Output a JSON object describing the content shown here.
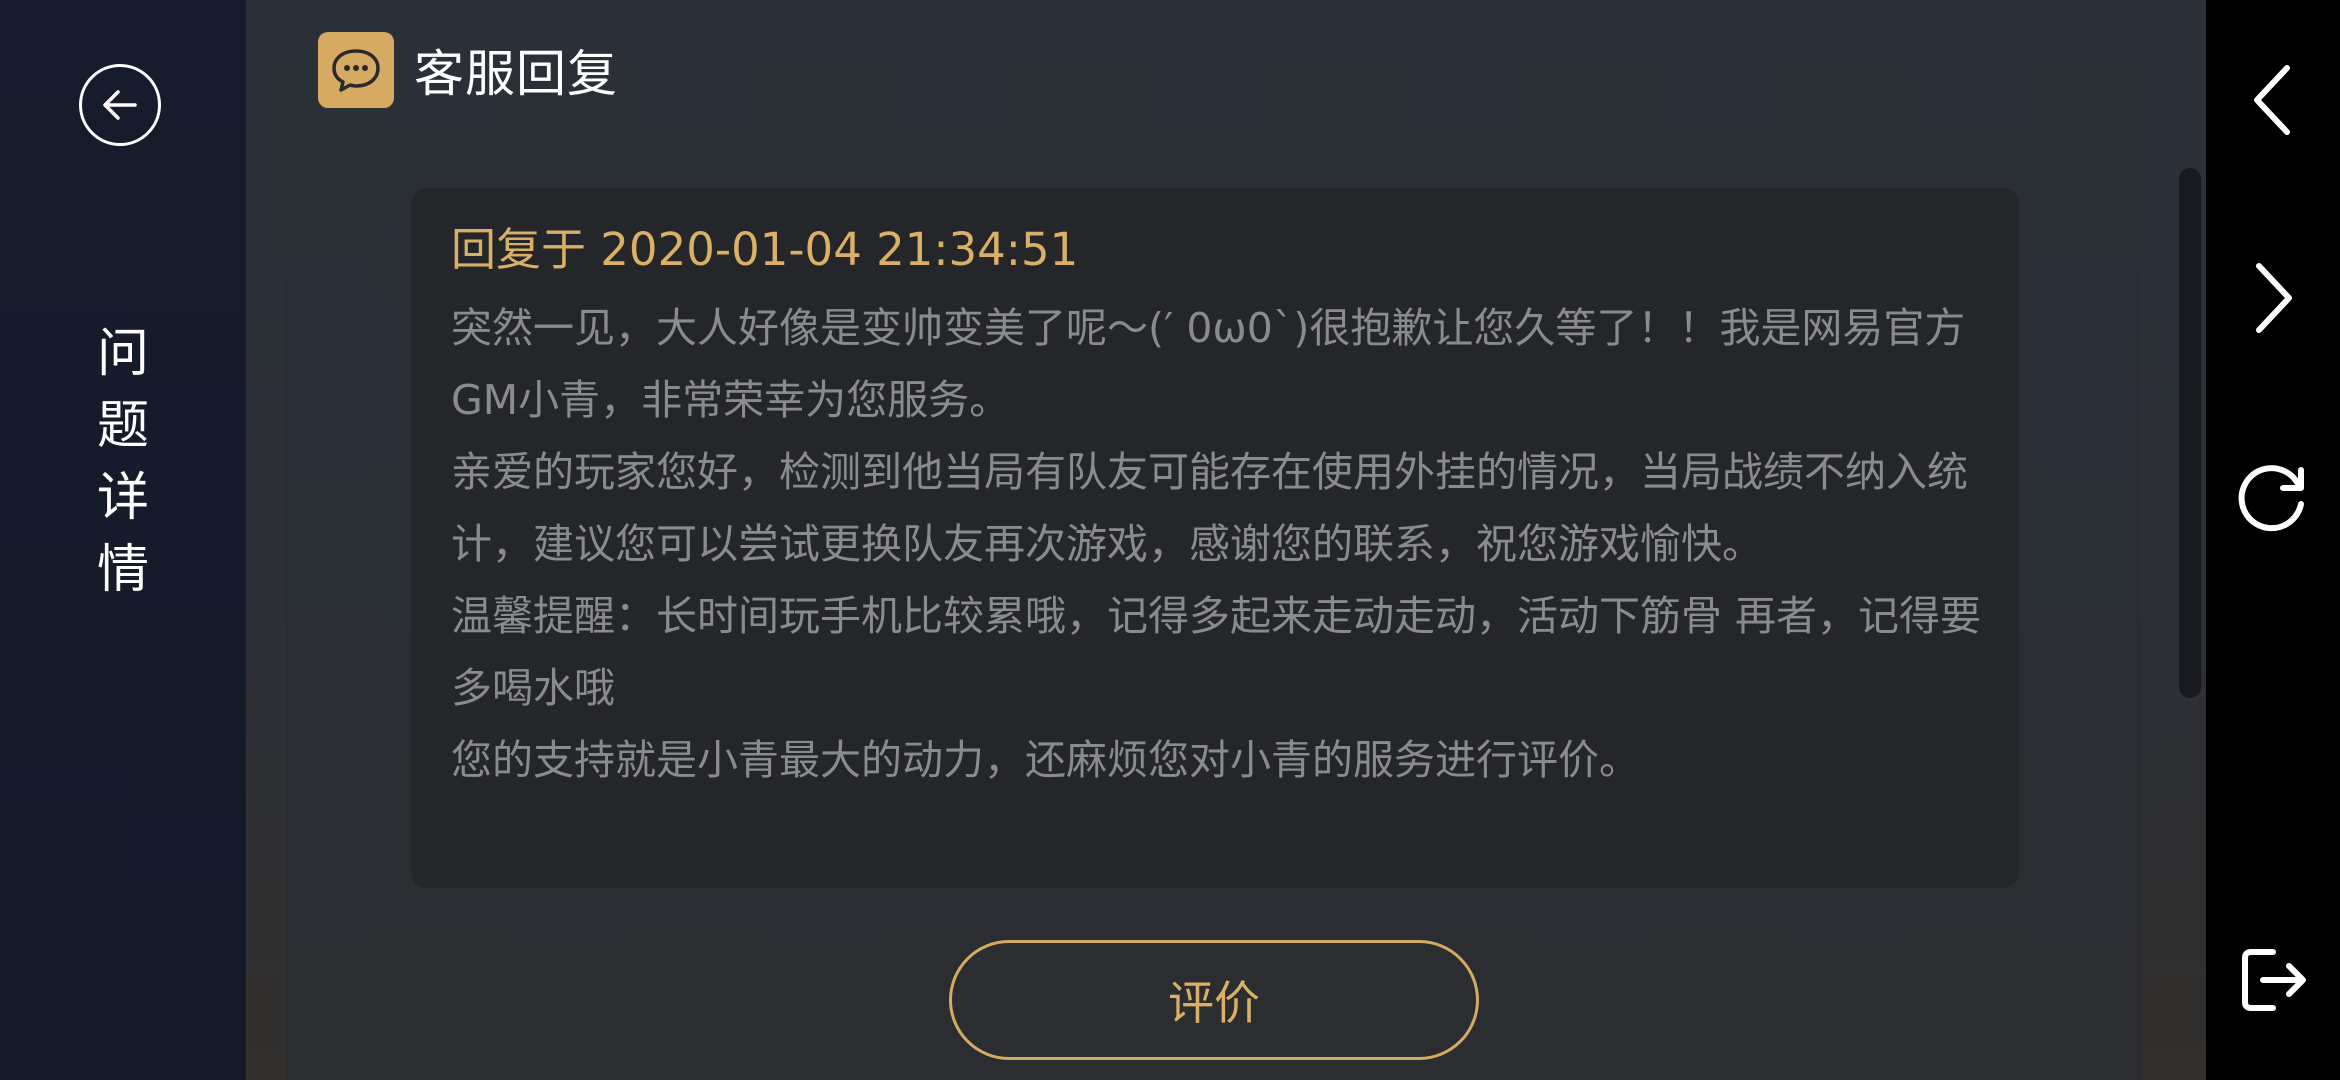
{
  "sidebar": {
    "back_icon": "back-arrow-circle-icon",
    "title_chars": [
      "问",
      "题",
      "详",
      "情"
    ]
  },
  "header": {
    "icon": "chat-bubble-icon",
    "title": "客服回复"
  },
  "reply": {
    "time_label": "回复于 2020-01-04 21:34:51",
    "paragraphs": [
      "突然一见，大人好像是变帅变美了呢～(′  0ω0`)很抱歉让您久等了！！我是网易官方GM小青，非常荣幸为您服务。",
      "亲爱的玩家您好，检测到他当局有队友可能存在使用外挂的情况，当局战绩不纳入统计，建议您可以尝试更换队友再次游戏，感谢您的联系，祝您游戏愉快。",
      "温馨提醒：长时间玩手机比较累哦，记得多起来走动走动，活动下筋骨 再者，记得要多喝水哦",
      "您的支持就是小青最大的动力，还麻烦您对小青的服务进行评价。"
    ]
  },
  "actions": {
    "rate_label": "评价"
  },
  "nav": {
    "back_icon": "chevron-left-icon",
    "forward_icon": "chevron-right-icon",
    "refresh_icon": "refresh-icon",
    "exit_icon": "exit-icon"
  },
  "colors": {
    "accent": "#d6aa62",
    "time_text": "#d9b065",
    "body_text": "#8a8b8e"
  }
}
